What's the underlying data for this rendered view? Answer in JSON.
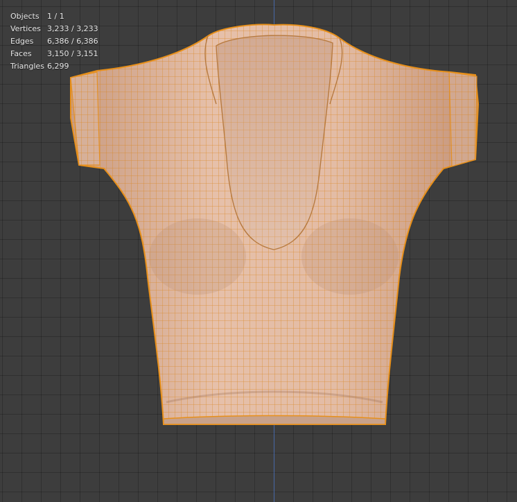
{
  "viewport": {
    "name": "3D Viewport",
    "background": "#3d3d3d",
    "mesh_color": "#e8b89a",
    "wire_color": "#e8901a",
    "axis_color": "#4a6fb6"
  },
  "stats": {
    "objects": {
      "label": "Objects",
      "value": "1 / 1"
    },
    "vertices": {
      "label": "Vertices",
      "value": "3,233 / 3,233"
    },
    "edges": {
      "label": "Edges",
      "value": "6,386 / 6,386"
    },
    "faces": {
      "label": "Faces",
      "value": "3,150 / 3,151"
    },
    "triangles": {
      "label": "Triangles",
      "value": "6,299"
    }
  }
}
